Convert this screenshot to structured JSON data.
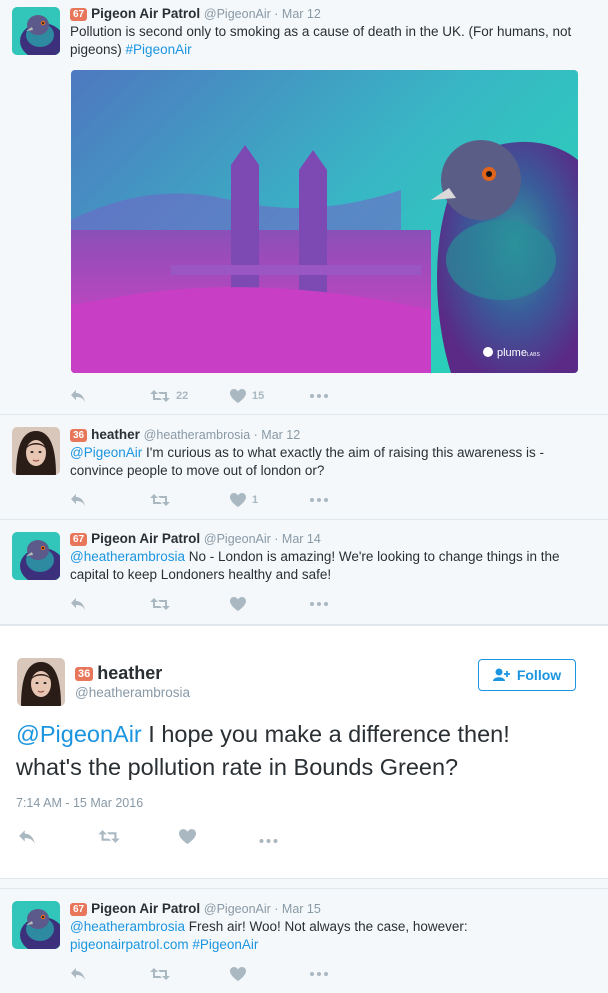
{
  "tweets": [
    {
      "badge": "67",
      "name": "Pigeon Air Patrol",
      "handle": "@PigeonAir",
      "date": "Mar 12",
      "text_plain": "Pollution is second only to smoking as a cause of death in the UK. (For humans, not pigeons) ",
      "text_hashtag": "#PigeonAir",
      "media_logo": "plume",
      "media_logo_sub": "LABS",
      "retweets": "22",
      "likes": "15"
    },
    {
      "badge": "36",
      "name": "heather",
      "handle": "@heatherambrosia",
      "date": "Mar 12",
      "text_mention": "@PigeonAir",
      "text_plain": " I'm curious as to what exactly the aim of raising this awareness is - convince people to move out of london or?",
      "retweets": "",
      "likes": "1"
    },
    {
      "badge": "67",
      "name": "Pigeon Air Patrol",
      "handle": "@PigeonAir",
      "date": "Mar 14",
      "text_mention": "@heatherambrosia",
      "text_plain": " No - London is amazing! We're looking to change things in the capital to keep Londoners healthy and safe!",
      "retweets": "",
      "likes": ""
    }
  ],
  "focus": {
    "badge": "36",
    "name": "heather",
    "handle": "@heatherambrosia",
    "follow_label": "Follow",
    "text_mention": "@PigeonAir",
    "text_plain": " I hope you make a difference then! what's the pollution rate in Bounds Green?",
    "timestamp": "7:14 AM - 15 Mar 2016"
  },
  "last": {
    "badge": "67",
    "name": "Pigeon Air Patrol",
    "handle": "@PigeonAir",
    "date": "Mar 15",
    "text_mention": "@heatherambrosia",
    "text_plain": " Fresh air! Woo! Not always the case, however: ",
    "text_link": "pigeonairpatrol.com",
    "text_hashtag": "#PigeonAir"
  },
  "icons": [
    "reply-icon",
    "retweet-icon",
    "heart-icon",
    "more-icon",
    "follow-add-icon"
  ],
  "colors": {
    "link": "#1b95e0",
    "badge": "#e8765a",
    "icon": "#aab8c2",
    "teal": "#2ec4b6",
    "magenta": "#d83ec9"
  }
}
